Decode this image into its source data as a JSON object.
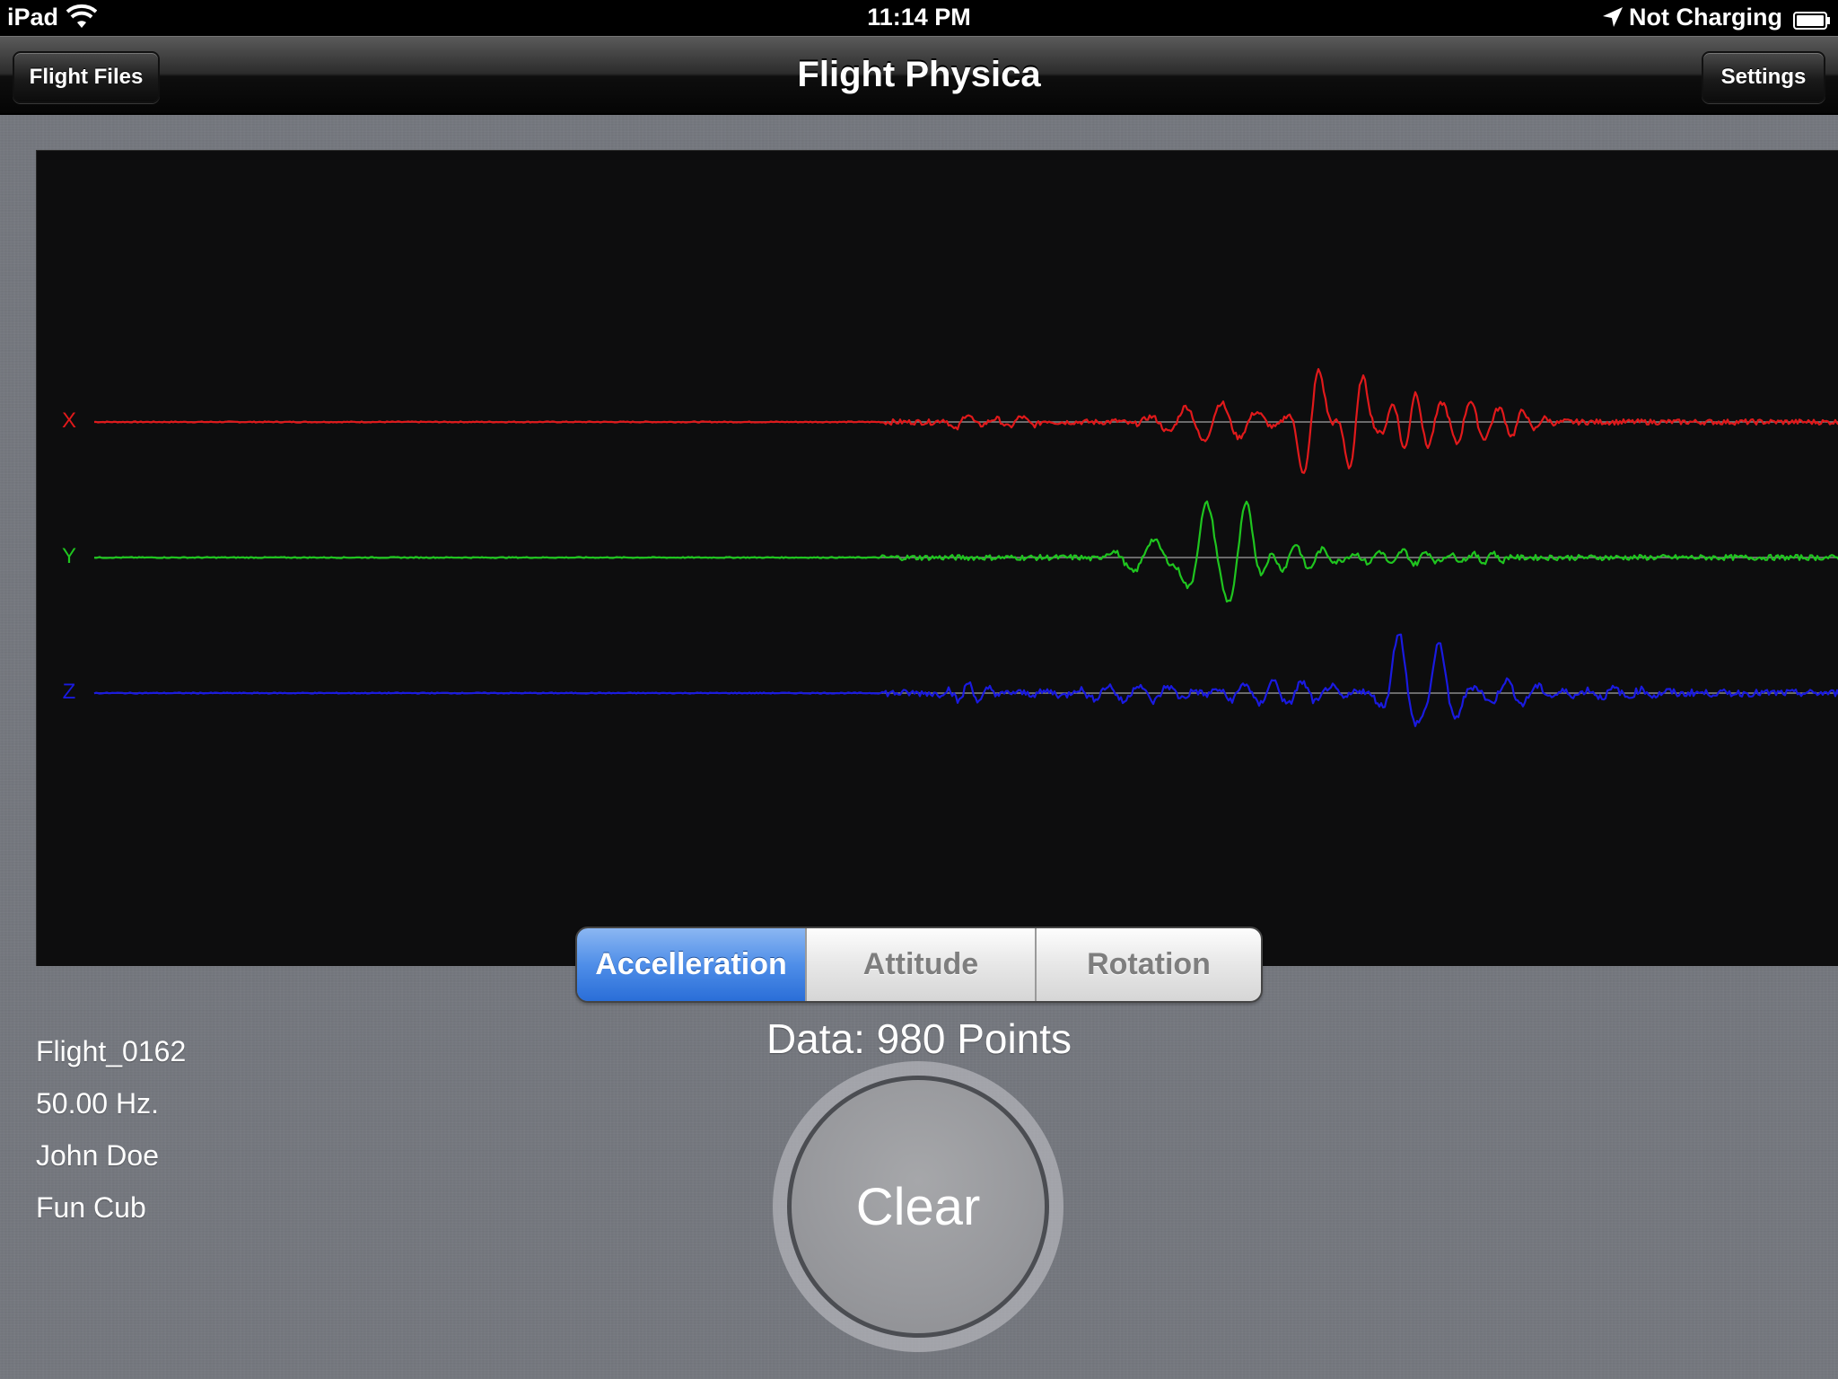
{
  "status_bar": {
    "device": "iPad",
    "time": "11:14 PM",
    "charging": "Not Charging",
    "icons": [
      "wifi-icon",
      "location-arrow-icon",
      "battery-icon"
    ]
  },
  "nav": {
    "title": "Flight Physica",
    "left_button": "Flight Files",
    "right_button": "Settings"
  },
  "graph": {
    "channels": [
      {
        "label": "X",
        "color": "#e0191b"
      },
      {
        "label": "Y",
        "color": "#1fc51f"
      },
      {
        "label": "Z",
        "color": "#1a1ae0"
      }
    ],
    "baseline_color": "#8a8a8a",
    "background": "#0d0d0e"
  },
  "segments": {
    "items": [
      "Accelleration",
      "Attitude",
      "Rotation"
    ],
    "selected": "Accelleration"
  },
  "data_count": "Data: 980 Points",
  "clear_label": "Clear",
  "flight_info": {
    "name": "Flight_0162",
    "rate": "50.00 Hz.",
    "pilot": "John Doe",
    "model": "Fun Cub"
  },
  "colors": {
    "accent": "#3d7fe2",
    "nav_bar": "#1a1a1a",
    "background": "#75787f"
  }
}
